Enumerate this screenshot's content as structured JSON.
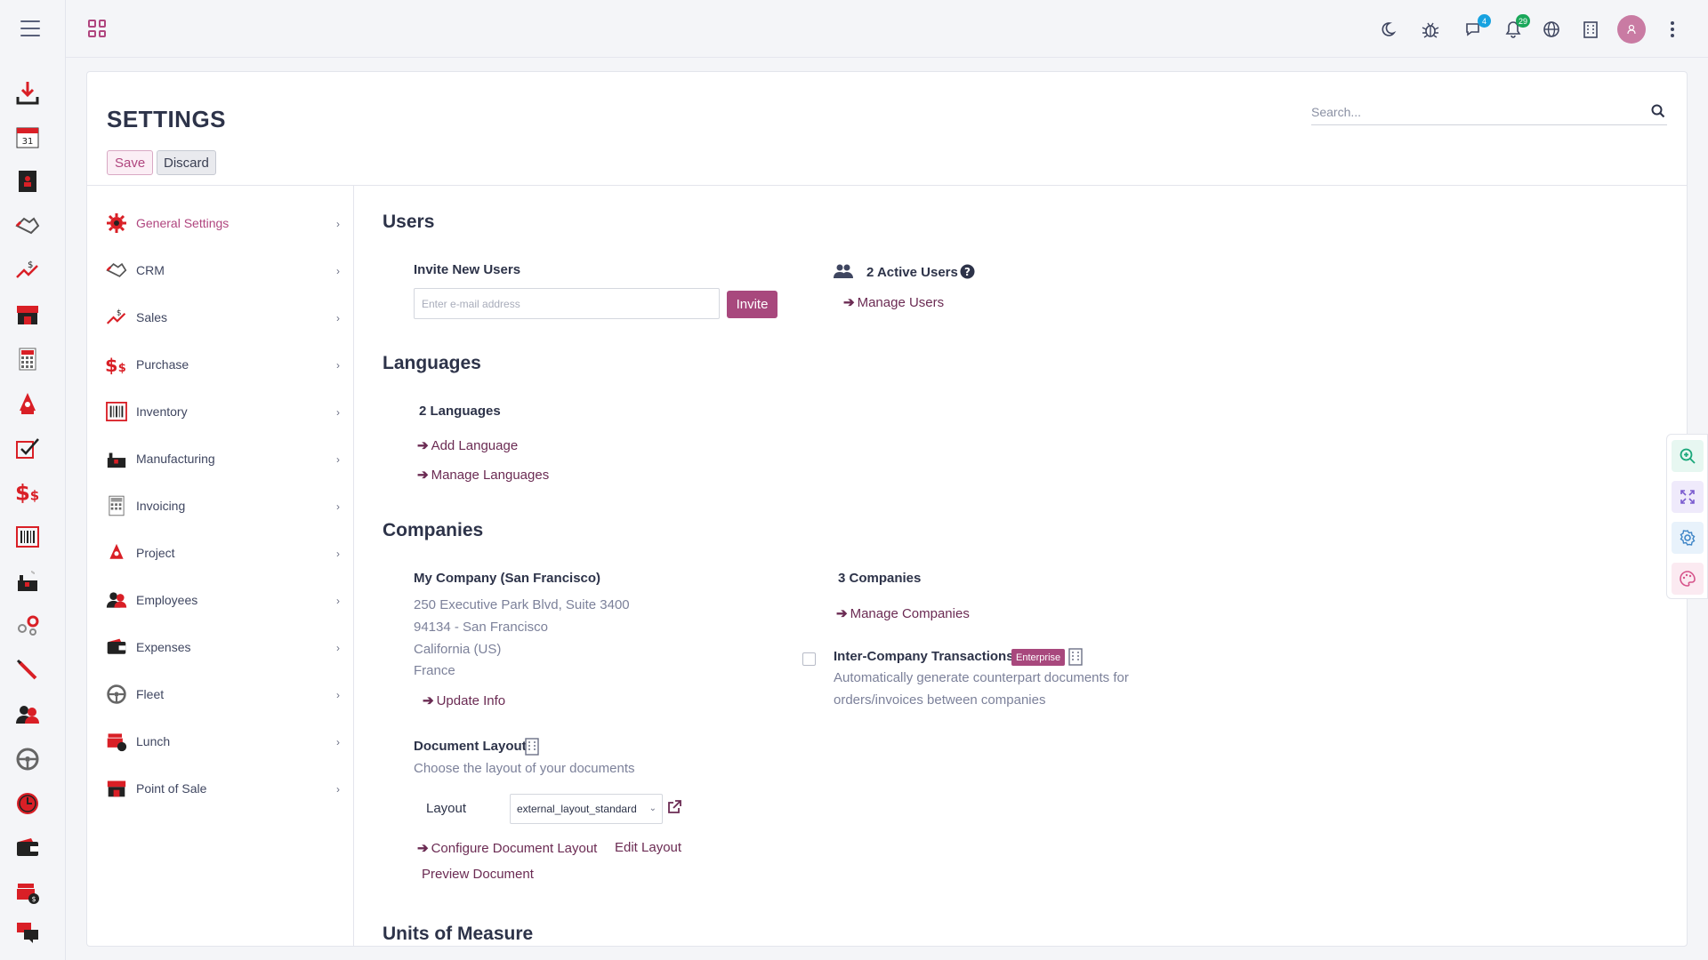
{
  "header": {
    "badges": {
      "chat": "4",
      "notifications": "29"
    },
    "icons": [
      "moon-icon",
      "bug-icon",
      "chat-icon",
      "bell-icon",
      "globe-icon",
      "building-icon",
      "avatar",
      "kebab-menu-icon"
    ]
  },
  "page": {
    "title": "SETTINGS",
    "save_label": "Save",
    "discard_label": "Discard",
    "search_placeholder": "Search..."
  },
  "sidebar": {
    "items": [
      {
        "label": "General Settings",
        "icon": "gear-icon",
        "active": true
      },
      {
        "label": "CRM",
        "icon": "handshake-icon"
      },
      {
        "label": "Sales",
        "icon": "sales-chart-icon"
      },
      {
        "label": "Purchase",
        "icon": "dollar-icon"
      },
      {
        "label": "Inventory",
        "icon": "barcode-icon"
      },
      {
        "label": "Manufacturing",
        "icon": "factory-icon"
      },
      {
        "label": "Invoicing",
        "icon": "calculator-icon"
      },
      {
        "label": "Project",
        "icon": "rocket-icon"
      },
      {
        "label": "Employees",
        "icon": "people-icon"
      },
      {
        "label": "Expenses",
        "icon": "wallet-icon"
      },
      {
        "label": "Fleet",
        "icon": "steering-wheel-icon"
      },
      {
        "label": "Lunch",
        "icon": "lunchbox-icon"
      },
      {
        "label": "Point of Sale",
        "icon": "store-icon"
      }
    ]
  },
  "users": {
    "heading": "Users",
    "invite_label": "Invite New Users",
    "email_placeholder": "Enter e-mail address",
    "invite_button": "Invite",
    "active_users": "2 Active Users",
    "manage_users": "Manage Users"
  },
  "languages": {
    "heading": "Languages",
    "count": "2 Languages",
    "add_language": "Add Language",
    "manage_languages": "Manage Languages"
  },
  "companies": {
    "heading": "Companies",
    "company_name": "My Company (San Francisco)",
    "address_line1": "250 Executive Park Blvd, Suite 3400",
    "address_line2": "94134 - San Francisco",
    "address_line3": "California (US)",
    "address_line4": "France",
    "update_info": "Update Info",
    "count": "3 Companies",
    "manage_companies": "Manage Companies",
    "intercompany_title": "Inter-Company Transactions",
    "enterprise_badge": "Enterprise",
    "intercompany_desc1": "Automatically generate counterpart documents for",
    "intercompany_desc2": "orders/invoices between companies",
    "doc_layout_title": "Document Layout",
    "doc_layout_desc": "Choose the layout of your documents",
    "layout_label": "Layout",
    "layout_value": "external_layout_standard",
    "configure_layout": "Configure Document Layout",
    "edit_layout": "Edit Layout",
    "preview_document": "Preview Document"
  },
  "units": {
    "heading": "Units of Measure"
  },
  "colors": {
    "accent": "#a8487d",
    "link": "#6b2b53",
    "app_red": "#d91f26"
  }
}
